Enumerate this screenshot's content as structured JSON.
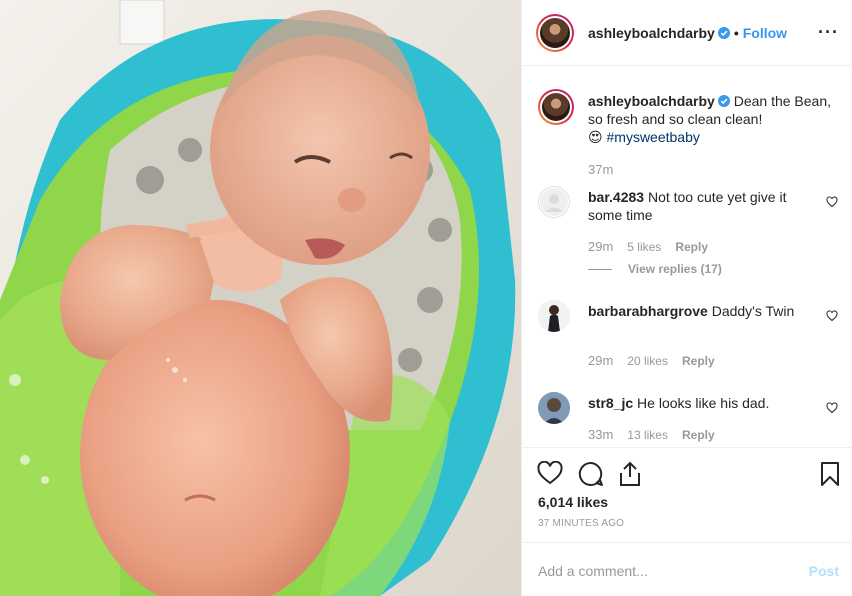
{
  "post": {
    "image_alt": "Newborn baby in a green and blue baby bath"
  },
  "header": {
    "username": "ashleyboalchdarby",
    "separator": "•",
    "follow_label": "Follow",
    "more_icon": "···"
  },
  "caption": {
    "username": "ashleyboalchdarby",
    "text": " Dean the Bean, so fresh and so clean clean!",
    "emoji": "😍",
    "hashtag": "#mysweetbaby",
    "time": "37m"
  },
  "comments": [
    {
      "username": "bar.4283",
      "text": " Not too cute yet give it some time",
      "time": "29m",
      "likes": "5 likes",
      "reply": "Reply",
      "view_replies": "View replies (17)"
    },
    {
      "username": "barbarabhargrove",
      "text": " Daddy's Twin",
      "time": "29m",
      "likes": "20 likes",
      "reply": "Reply"
    },
    {
      "username": "str8_jc",
      "text": " He looks like his dad.",
      "time": "33m",
      "likes": "13 likes",
      "reply": "Reply"
    }
  ],
  "stats": {
    "likes": "6,014 likes",
    "posted": "37 MINUTES AGO"
  },
  "add_comment": {
    "placeholder": "Add a comment...",
    "post_label": "Post"
  },
  "colors": {
    "link_blue": "#3897f0",
    "hashtag_blue": "#003569",
    "muted_gray": "#999999",
    "post_disabled": "#b2dffc"
  }
}
